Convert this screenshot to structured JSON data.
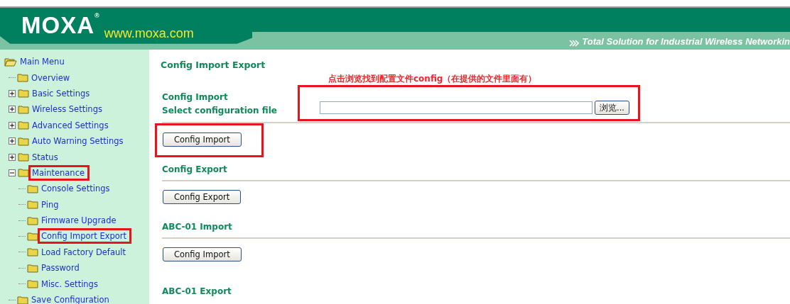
{
  "header": {
    "logo": "MOXA",
    "registered": "®",
    "url": "www.moxa.com",
    "tagline": "Total Solution for Industrial Wireless Networkin"
  },
  "sidebar": {
    "root": {
      "label": "Main Menu",
      "children": [
        {
          "label": "Overview",
          "kind": "page",
          "marked": false
        },
        {
          "label": "Basic Settings",
          "kind": "group",
          "expanded": false,
          "marked": false
        },
        {
          "label": "Wireless Settings",
          "kind": "group",
          "expanded": false,
          "marked": false
        },
        {
          "label": "Advanced Settings",
          "kind": "group",
          "expanded": false,
          "marked": false
        },
        {
          "label": "Auto Warning Settings",
          "kind": "group",
          "expanded": false,
          "marked": false
        },
        {
          "label": "Status",
          "kind": "group",
          "expanded": false,
          "marked": false
        },
        {
          "label": "Maintenance",
          "kind": "group",
          "expanded": true,
          "marked": true,
          "children": [
            {
              "label": "Console Settings",
              "kind": "page",
              "marked": false
            },
            {
              "label": "Ping",
              "kind": "page",
              "marked": false
            },
            {
              "label": "Firmware Upgrade",
              "kind": "page",
              "marked": false
            },
            {
              "label": "Config Import Export",
              "kind": "page",
              "marked": true
            },
            {
              "label": "Load Factory Default",
              "kind": "page",
              "marked": false
            },
            {
              "label": "Password",
              "kind": "page",
              "marked": false
            },
            {
              "label": "Misc. Settings",
              "kind": "page",
              "marked": false
            }
          ]
        },
        {
          "label": "Save Configuration",
          "kind": "page",
          "marked": false
        }
      ]
    }
  },
  "content": {
    "title": "Config Import Export",
    "note": "点击浏览找到配置文件config（在提供的文件里面有）",
    "sections": [
      {
        "kind": "file",
        "heading": "Config Import",
        "field_label": "Select configuration file",
        "browse": "浏览...",
        "field_marked": true,
        "button": "Config Import",
        "button_marked": true
      },
      {
        "kind": "button",
        "heading": "Config Export",
        "button": "Config Export",
        "button_marked": false
      },
      {
        "kind": "button",
        "heading": "ABC-01 Import",
        "button": "Config Import",
        "button_marked": false
      },
      {
        "kind": "heading",
        "heading": "ABC-01 Export"
      }
    ]
  }
}
